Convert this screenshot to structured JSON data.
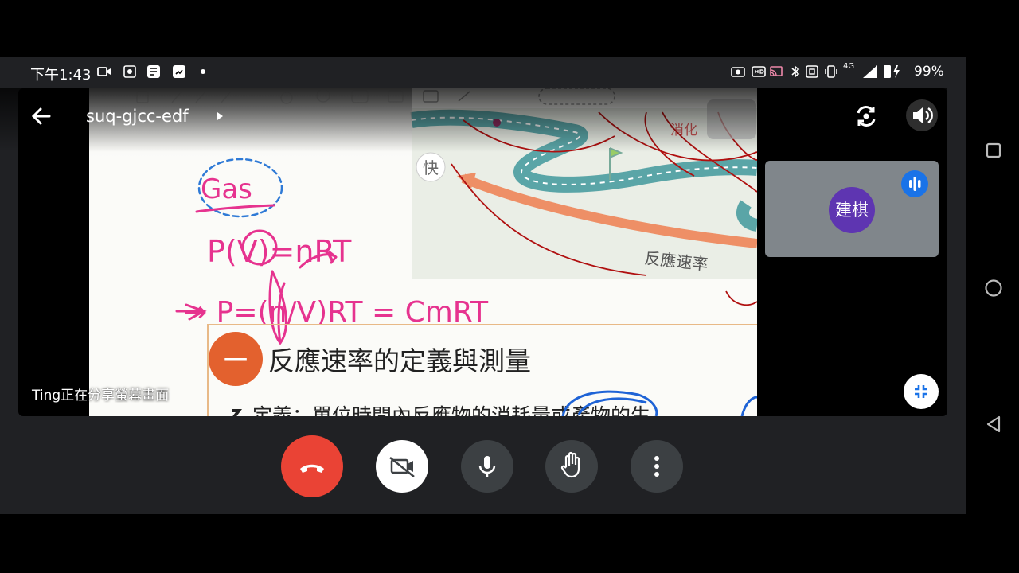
{
  "status_bar": {
    "time": "下午1:43",
    "battery": "99%",
    "network": "4G"
  },
  "meeting": {
    "code": "suq-gjcc-edf",
    "sharing_label": "Ting正在分享螢幕畫面"
  },
  "participant": {
    "name": "建棋"
  },
  "slide": {
    "handwriting": {
      "gas": "Gas",
      "eq1": "P(V)=nRT",
      "eq2": "→ P=(n/V)RT = CmRT"
    },
    "road_labels": {
      "fast": "快",
      "digest": "消化",
      "reaction_rate": "反應速率"
    },
    "section_number": "一",
    "section_title": "反應速率的定義與測量",
    "definition_line": "定義：單位時間內反應物的消耗量或產物的生"
  },
  "colors": {
    "end_call": "#ea4335",
    "avatar": "#5e35b1",
    "accent_blue": "#1a73e8",
    "ink_pink": "#e6338f",
    "section_badge": "#e3612e"
  }
}
